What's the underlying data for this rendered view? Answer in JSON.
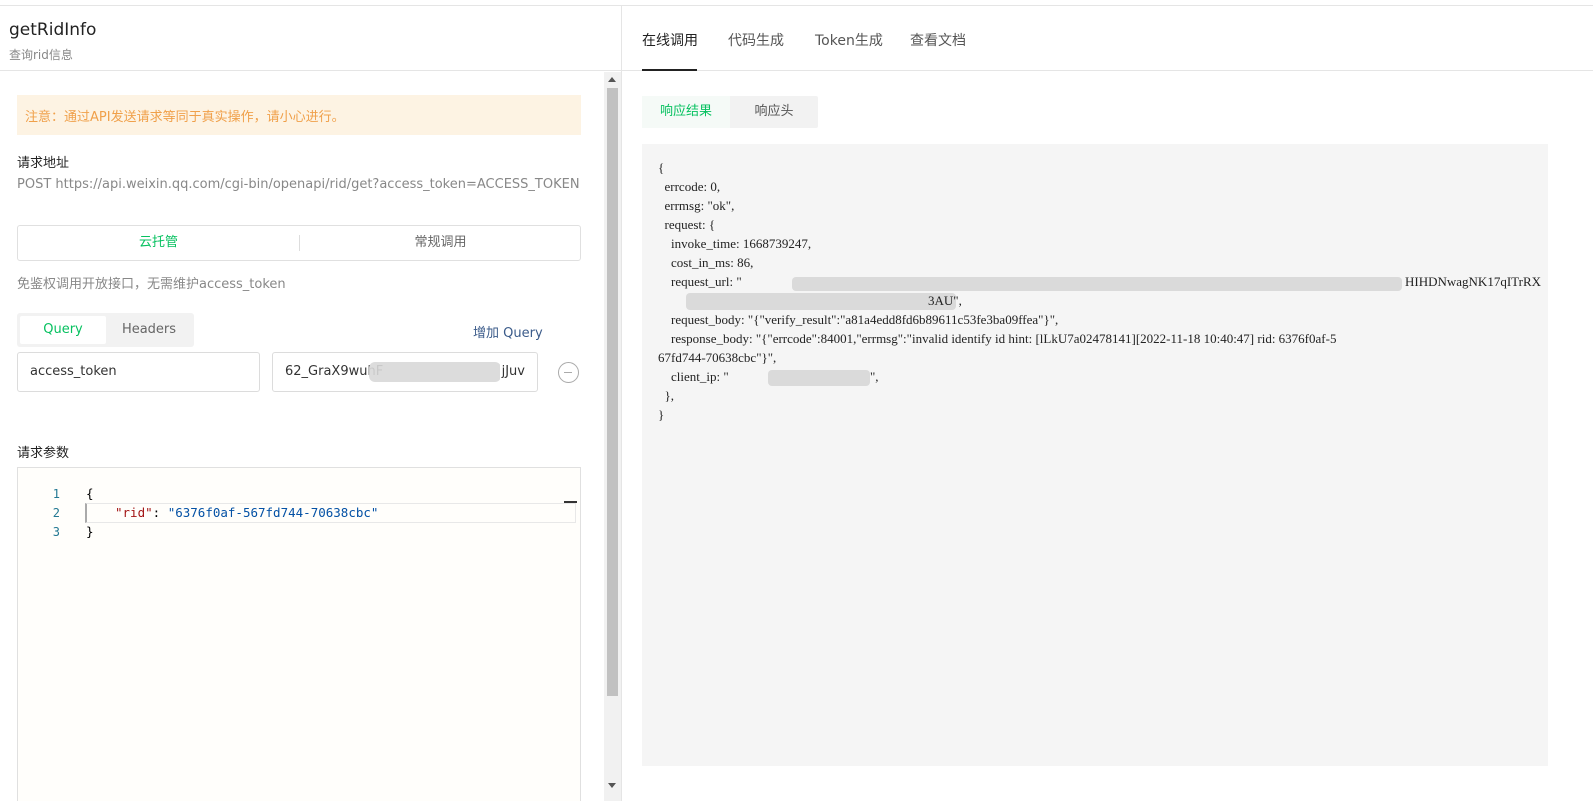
{
  "api": {
    "name": "getRidInfo",
    "desc": "查询rid信息"
  },
  "notice": "注意：通过API发送请求等同于真实操作，请小心进行。",
  "request_url": {
    "label": "请求地址",
    "value": "POST https://api.weixin.qq.com/cgi-bin/openapi/rid/get?access_token=ACCESS_TOKEN"
  },
  "mode": {
    "options": [
      "云托管",
      "常规调用"
    ],
    "selected": "云托管",
    "hint": "免鉴权调用开放接口，无需维护access_token"
  },
  "query": {
    "tabs": [
      "Query",
      "Headers"
    ],
    "add_label": "增加 Query",
    "rows": [
      {
        "key": "access_token",
        "value_prefix": "62_GraX9wuhF",
        "value_suffix": "jJuv"
      }
    ]
  },
  "params": {
    "label": "请求参数",
    "line_numbers": [
      "1",
      "2",
      "3"
    ],
    "lines": [
      "{",
      "\"rid\"",
      ": ",
      "\"6376f0af-567fd744-70638cbc\"",
      "}"
    ]
  },
  "right_tabs": [
    "在线调用",
    "代码生成",
    "Token生成",
    "查看文档"
  ],
  "response_tabs": [
    "响应结果",
    "响应头"
  ],
  "response": {
    "lines": [
      "{",
      "  errcode: 0,",
      "  errmsg: \"ok\",",
      "  request: {",
      "    invoke_time: 1668739247,",
      "    cost_in_ms: 86,",
      "    request_url: \"",
      "HIHDNwagNK17qITrRX",
      "3AU\",",
      "    request_body: \"{\"verify_result\":\"a81a4edd8fd6b89611c53fe3ba09ffea\"}\",",
      "    response_body: \"{\"errcode\":84001,\"errmsg\":\"invalid identify id hint: [lLkU7a02478141][2022-11-18 10:40:47] rid: 6376f0af-5",
      "67fd744-70638cbc\"}\",",
      "    client_ip: \"",
      "\",",
      "  },",
      "}"
    ]
  },
  "colors": {
    "accent": "#07c160",
    "notice_bg": "#fdf3e3",
    "notice_text": "#f0a04a"
  }
}
